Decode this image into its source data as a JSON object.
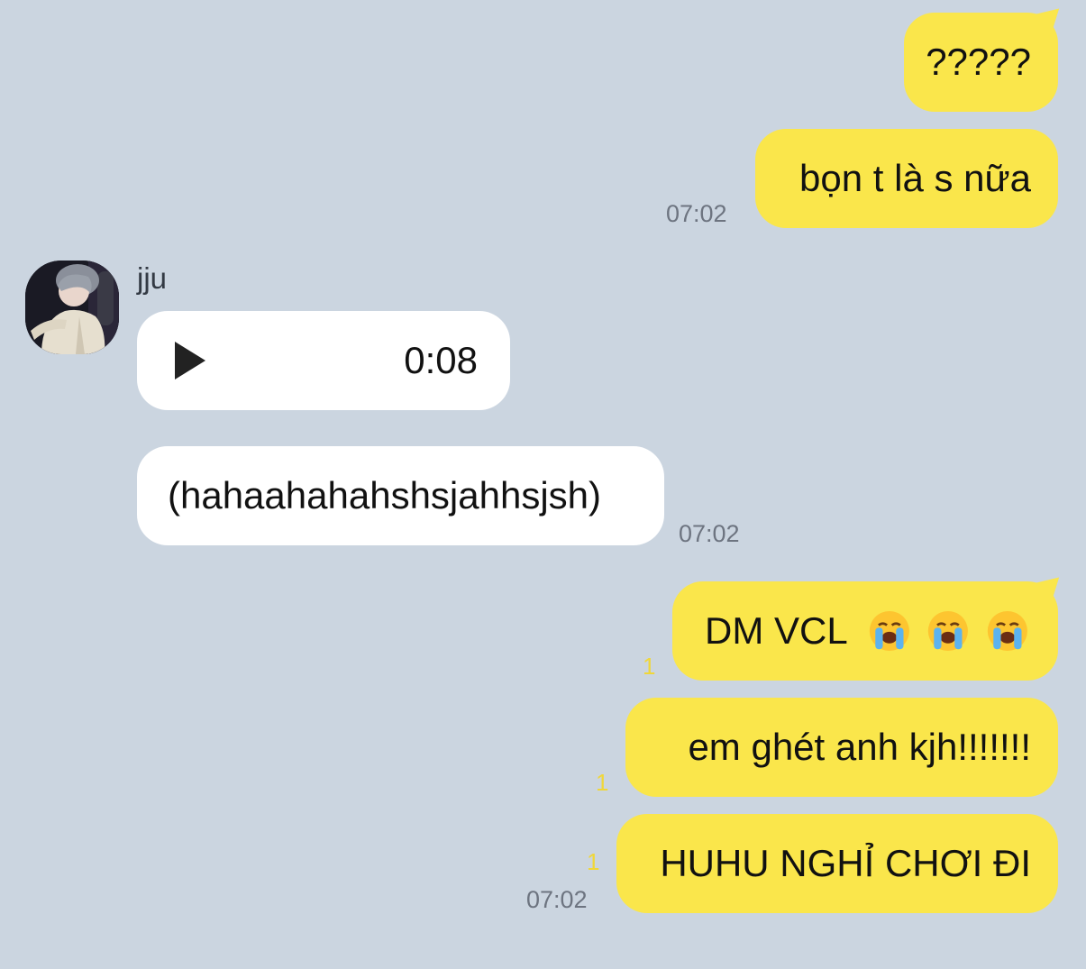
{
  "messages": {
    "m1": {
      "text": "?????"
    },
    "m2": {
      "text": "bọn t là s nữa",
      "time": "07:02"
    },
    "incoming": {
      "sender": "jju",
      "avatar_icon": "avatar-photo",
      "voice": {
        "play_icon": "play-icon",
        "duration": "0:08"
      },
      "text": "(hahaahahahshsjahhsjsh)",
      "time": "07:02"
    },
    "m3": {
      "text": "DM VCL",
      "unread": "1",
      "emojis": [
        "loudly-crying-face-icon",
        "loudly-crying-face-icon",
        "loudly-crying-face-icon"
      ]
    },
    "m4": {
      "text": "em ghét anh kjh!!!!!!!",
      "unread": "1"
    },
    "m5": {
      "text": "HUHU NGHỈ CHƠI ĐI",
      "unread": "1",
      "time": "07:02"
    }
  },
  "colors": {
    "background": "#cbd5e0",
    "outgoing_bubble": "#fae64b",
    "incoming_bubble": "#ffffff",
    "unread_count": "#f0d73a",
    "timestamp": "#6d7480"
  }
}
